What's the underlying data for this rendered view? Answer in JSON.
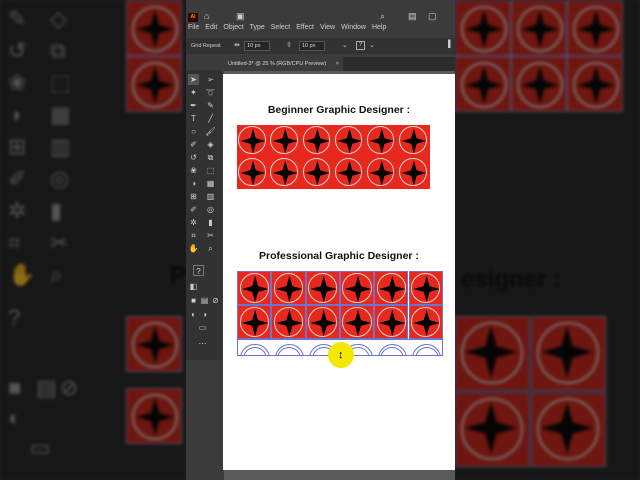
{
  "menu": [
    "File",
    "Edit",
    "Object",
    "Type",
    "Select",
    "Effect",
    "View",
    "Window",
    "Help"
  ],
  "app_logo": "Ai",
  "control_bar": {
    "label": "Grid Repeat",
    "spacing_h": "10 px",
    "spacing_v": "10 px",
    "help": "?"
  },
  "document_tab": {
    "title": "Untitled-3* @ 25 % (RGB/CPU Preview)",
    "close": "×"
  },
  "artboard": {
    "beginner_heading": "Beginner Graphic Designer :",
    "professional_heading": "Professional Graphic Designer :",
    "beginner_grid": {
      "rows": 2,
      "cols": 6
    },
    "professional_grid": {
      "rows": 2,
      "cols": 6,
      "partial_row_cols": 6
    }
  },
  "background_text": {
    "left": "P",
    "right": "esigner :"
  },
  "colors": {
    "tile_red": "#e8281c",
    "star": "#000000",
    "ring": "#d8d8d8",
    "selection": "#6c74cf",
    "cursor": "#f4e800"
  },
  "icons": [
    "home-icon",
    "arrange-docs-icon",
    "search-icon",
    "workspace-icon",
    "panel-icon"
  ],
  "tools": [
    "selection-tool",
    "direct-selection-tool",
    "magic-wand-tool",
    "lasso-tool",
    "pen-tool",
    "curvature-tool",
    "type-tool",
    "line-tool",
    "ellipse-tool",
    "paintbrush-tool",
    "shaper-tool",
    "eraser-tool",
    "rotate-tool",
    "scale-tool",
    "warp-tool",
    "free-transform-tool",
    "shape-builder-tool",
    "perspective-tool",
    "mesh-tool",
    "gradient-tool",
    "eyedropper-tool",
    "blend-tool",
    "symbol-sprayer-tool",
    "column-graph-tool",
    "artboard-tool",
    "slice-tool",
    "hand-tool",
    "zoom-tool"
  ],
  "tool_help": "?"
}
